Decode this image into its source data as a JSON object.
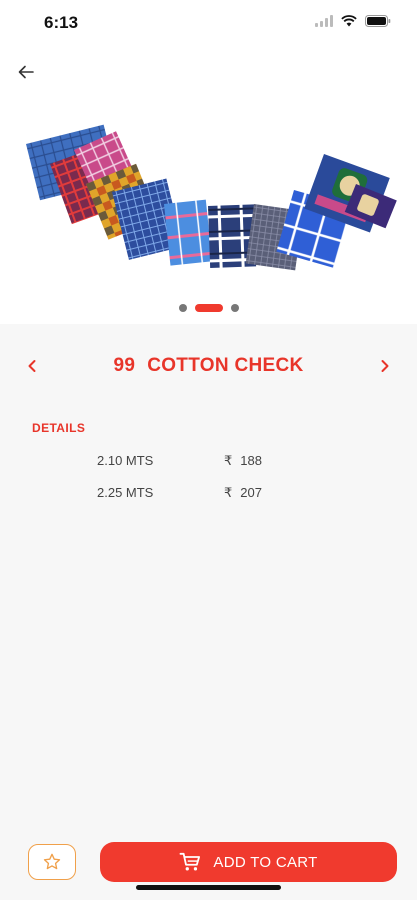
{
  "status_bar": {
    "time": "6:13"
  },
  "gallery": {
    "slide_count": 3,
    "active_slide": 2
  },
  "product": {
    "code": "99",
    "name": "COTTON CHECK"
  },
  "details": {
    "label": "DETAILS",
    "currency": "₹",
    "rows": [
      {
        "length": "2.10 MTS",
        "price": "188"
      },
      {
        "length": "2.25 MTS",
        "price": "207"
      }
    ]
  },
  "actions": {
    "add_to_cart_label": "ADD TO CART"
  },
  "colors": {
    "accent": "#f03a2e",
    "favorite_border": "#f0a04a",
    "background": "#f7f7f7"
  },
  "icons": {
    "back": "back-arrow-icon",
    "prev": "chevron-left-icon",
    "next": "chevron-right-icon",
    "favorite": "star-icon",
    "cart": "cart-icon"
  }
}
